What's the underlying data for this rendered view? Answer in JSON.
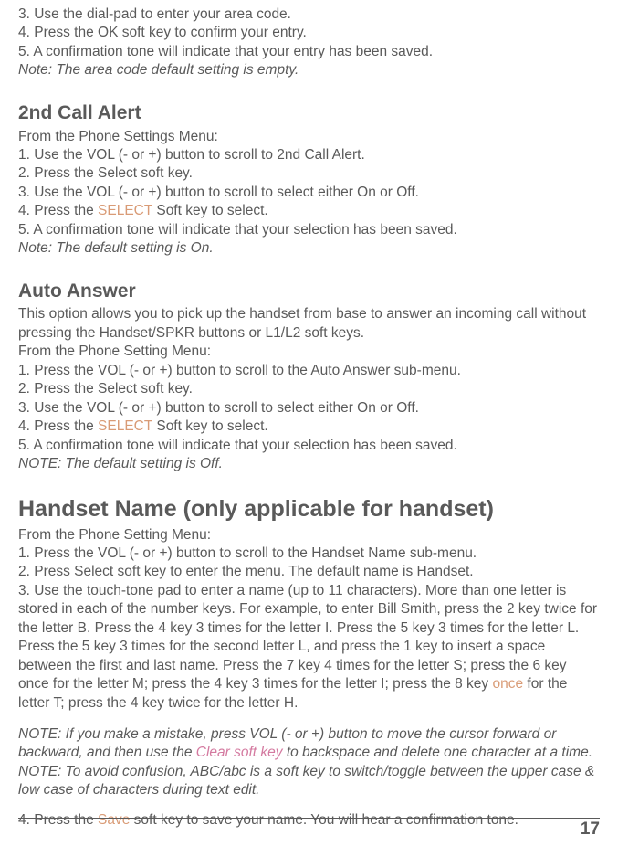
{
  "intro": {
    "line3": "3. Use the dial-pad to enter your area code.",
    "line4": "4. Press the OK soft key to confirm your entry.",
    "line5": "5. A confirmation tone will indicate that your entry has been saved.",
    "note": "Note: The area code default setting is empty."
  },
  "second_call": {
    "heading": "2nd Call Alert",
    "intro": "From the Phone Settings Menu:",
    "line1": "1. Use the VOL (- or +) button to scroll to 2nd Call Alert.",
    "line2": "2. Press the Select soft key.",
    "line3": "3. Use the VOL (- or +) button to scroll to select either On or Off.",
    "line4a": "4. Press the ",
    "line4b": "SELECT",
    "line4c": " Soft key to select.",
    "line5": "5. A confirmation tone will indicate that your selection has been saved.",
    "note": "Note: The default setting is On."
  },
  "auto_answer": {
    "heading": "Auto Answer",
    "desc": "This option allows you to pick up the handset from base to answer an incoming call without pressing the Handset/SPKR buttons or L1/L2 soft keys.",
    "intro": "From the Phone Setting Menu:",
    "line1": "1. Press the VOL (- or +) button to scroll to the Auto Answer sub-menu.",
    "line2": "2.  Press the Select soft key.",
    "line3": "3.  Use the VOL (- or +) button to scroll to select either On or Off.",
    "line4a": "4.  Press the ",
    "line4b": "SELECT",
    "line4c": " Soft key to select.",
    "line5": "5.  A confirmation tone will indicate that your selection has been saved.",
    "note": "NOTE: The default setting is Off."
  },
  "handset": {
    "heading": "Handset Name (only applicable for handset)",
    "intro": "From the Phone Setting Menu:",
    "line1": "1. Press the VOL (- or +) button to scroll to the Handset Name sub-menu.",
    "line2": "2. Press Select soft key to enter the menu. The default name is Handset.",
    "line3a": "3. Use the touch-tone pad to enter a name (up to 11 characters). More than one letter is stored in each of the number keys. For example, to enter Bill Smith, press the 2 key twice for the letter B. Press the 4 key 3 times for the letter I. Press the 5 key 3 times for the letter L. Press the 5 key 3 times for the second letter L, and press the 1 key to insert a space between the first and last name. Press the 7 key 4 times for the letter S; press the 6 key once for the letter M; press the 4 key 3 times for the letter I; press the 8 key ",
    "line3b": "once",
    "line3c": " for the letter T; press the 4 key twice for the letter H.",
    "note1a": "NOTE: If you make a mistake, press VOL (- or +) button to move the cursor forward or backward, and then use the ",
    "note1b": "Clear soft key",
    "note1c": " to backspace and delete one character at a time.",
    "note2": "NOTE: To avoid confusion, ABC/abc is a soft key to switch/toggle between the upper case & low case of characters during text edit.",
    "line4a": "4. Press the ",
    "line4b": "Save",
    "line4c": " soft key to save your name. You will hear a confirmation tone."
  },
  "page_number": "17"
}
